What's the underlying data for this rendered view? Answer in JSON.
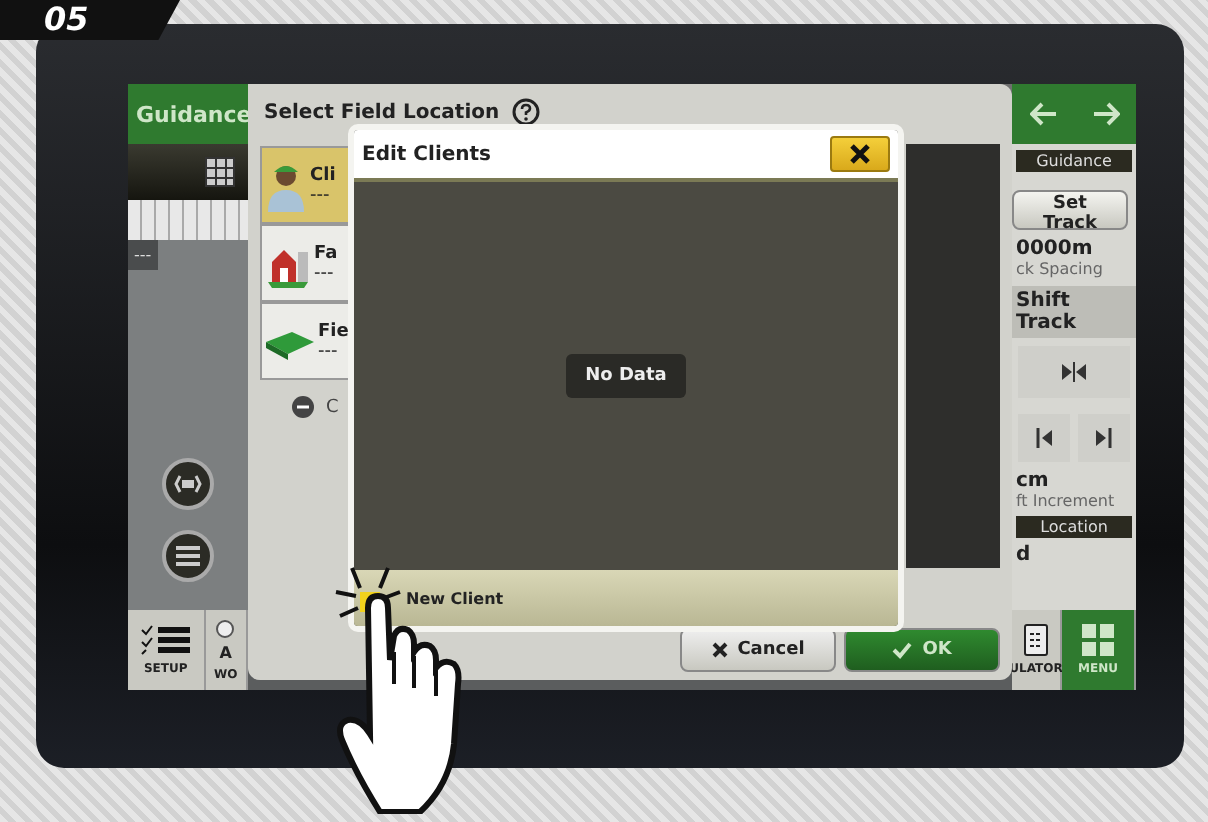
{
  "badge": "05",
  "left_panel": {
    "header": "Guidance",
    "chip": "---"
  },
  "right_panel": {
    "header": "Guidance",
    "set_track": "Set Track",
    "spacing_value": "0000m",
    "spacing_label": "ck Spacing",
    "shift_title": "Shift Track",
    "increment_value": "cm",
    "increment_label": "ft Increment",
    "location_header": "Location",
    "location_value": "d"
  },
  "bottom_bar": {
    "setup": "SETUP",
    "radio_label": "A",
    "radio_checked": false,
    "work": "WO",
    "calculator": "ULATOR",
    "menu": "MENU"
  },
  "select_dialog": {
    "title": "Select Field Location",
    "items": [
      {
        "kind": "client",
        "label": "Cli",
        "value": "---",
        "selected": true
      },
      {
        "kind": "farm",
        "label": "Fa",
        "value": "---",
        "selected": false
      },
      {
        "kind": "field",
        "label": "Fie",
        "value": "---",
        "selected": false
      }
    ],
    "remove_label": "C",
    "buttons": [
      {
        "kind": "cancel",
        "label": "Cancel"
      },
      {
        "kind": "ok",
        "label": "OK"
      }
    ]
  },
  "edit_dialog": {
    "title": "Edit Clients",
    "empty_message": "No Data",
    "new_label": "New Client"
  }
}
